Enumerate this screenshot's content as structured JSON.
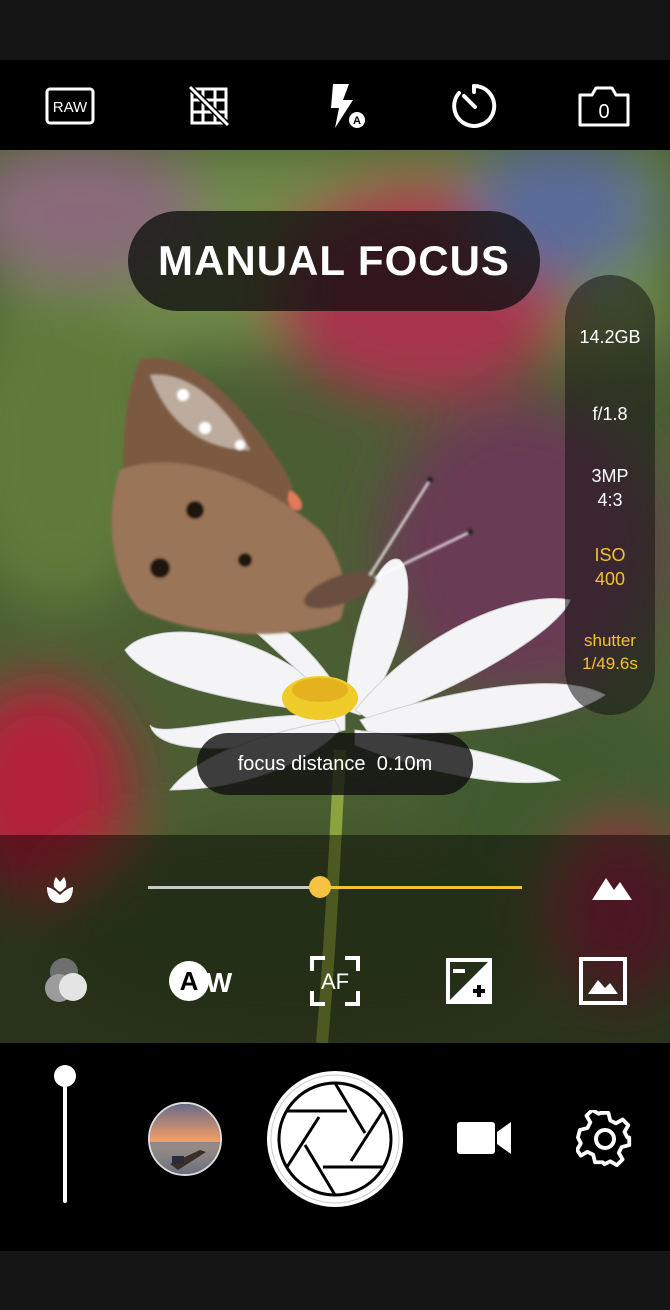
{
  "top_bar": {
    "raw_label": "RAW",
    "flash_mode_letter": "A",
    "camera_switch_label": "0",
    "icons": [
      "raw-icon",
      "grid-off-icon",
      "flash-auto-icon",
      "timer-icon",
      "switch-camera-icon"
    ]
  },
  "viewfinder": {
    "mode_label": "MANUAL FOCUS",
    "focus_distance_label": "focus distance",
    "focus_distance_value": "0.10m"
  },
  "info_panel": {
    "storage": "14.2GB",
    "aperture": "f/1.8",
    "resolution_mp": "3MP",
    "aspect_ratio": "4:3",
    "iso_label": "ISO",
    "iso_value": "400",
    "shutter_label": "shutter",
    "shutter_value": "1/49.6s"
  },
  "focus_slider": {
    "value_fraction": 0.46,
    "min_icon": "macro-flower-icon",
    "max_icon": "mountain-icon"
  },
  "controls": {
    "awb_letter": "A",
    "awb_suffix": "W",
    "af_label": "AF",
    "icons": [
      "filter-icon",
      "awb-icon",
      "af-icon",
      "exposure-icon",
      "gallery-icon"
    ]
  },
  "bottom_bar": {
    "zoom_level": 0.0,
    "icons": [
      "zoom-slider",
      "thumbnail",
      "shutter-icon",
      "video-icon",
      "settings-icon"
    ]
  },
  "colors": {
    "accent": "#f1c232",
    "bar": "#000000"
  }
}
